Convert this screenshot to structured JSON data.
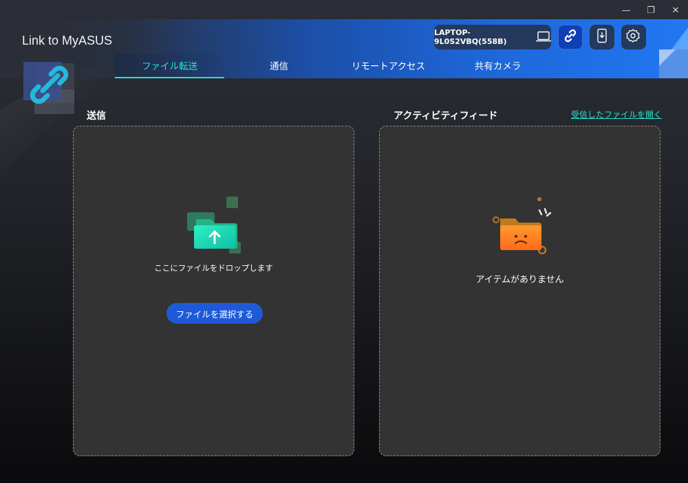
{
  "window": {
    "title": "Link to MyASUS",
    "controls": {
      "minimize": "—",
      "restore": "❐",
      "close": "✕"
    }
  },
  "header": {
    "device_name": "LAPTOP-9L0S2VBQ(558B)",
    "icons": [
      "laptop-icon",
      "link-icon",
      "phone-download-icon",
      "settings-icon"
    ]
  },
  "tabs": [
    {
      "label": "ファイル転送",
      "active": true
    },
    {
      "label": "通信",
      "active": false
    },
    {
      "label": "リモートアクセス",
      "active": false
    },
    {
      "label": "共有カメラ",
      "active": false
    }
  ],
  "send": {
    "title": "送信",
    "drop_text": "ここにファイルをドロップします",
    "select_button": "ファイルを選択する"
  },
  "activity": {
    "title": "アクティビティフィード",
    "open_link": "受信したファイルを開く",
    "empty_text": "アイテムがありません"
  },
  "colors": {
    "accent": "#27e3d2",
    "primary_button": "#1e5ad8",
    "panel": "#333333",
    "header_blue": "#2277f2"
  }
}
